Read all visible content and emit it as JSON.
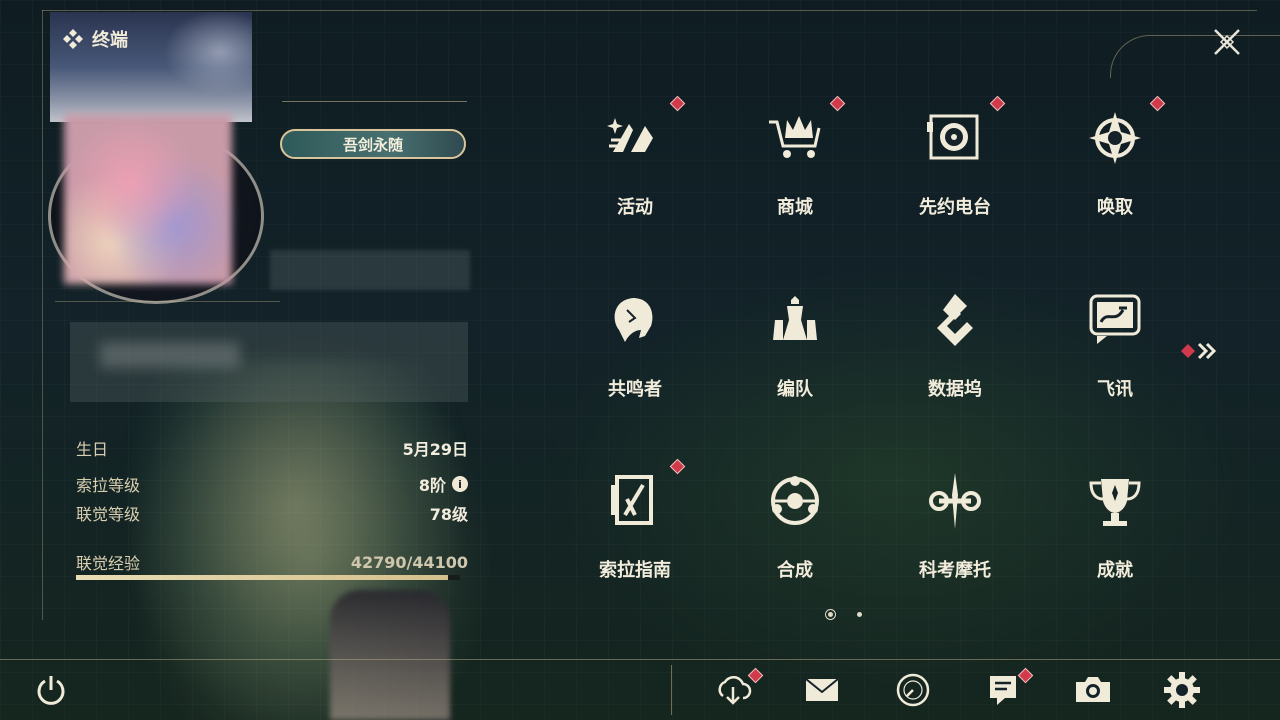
{
  "header": {
    "title": "终端"
  },
  "profile": {
    "title_badge": "吾剑永随",
    "stats": [
      {
        "label": "生日",
        "value": "5月29日"
      },
      {
        "label": "索拉等级",
        "value": "8阶"
      },
      {
        "label": "联觉等级",
        "value": "78级"
      }
    ],
    "exp": {
      "label": "联觉经验",
      "value": "42790/44100",
      "progress": 0.97
    },
    "info_icon": "i"
  },
  "menu": {
    "items": [
      {
        "label": "活动",
        "icon": "activity-icon",
        "badge": true
      },
      {
        "label": "商城",
        "icon": "shop-icon",
        "badge": true
      },
      {
        "label": "先约电台",
        "icon": "radio-icon",
        "badge": true
      },
      {
        "label": "唤取",
        "icon": "summon-icon",
        "badge": true
      },
      {
        "label": "共鸣者",
        "icon": "resonator-icon",
        "badge": false
      },
      {
        "label": "编队",
        "icon": "team-icon",
        "badge": false
      },
      {
        "label": "数据坞",
        "icon": "databank-icon",
        "badge": false
      },
      {
        "label": "飞讯",
        "icon": "message-icon",
        "badge": false
      },
      {
        "label": "索拉指南",
        "icon": "guide-icon",
        "badge": true
      },
      {
        "label": "合成",
        "icon": "synthesis-icon",
        "badge": false
      },
      {
        "label": "科考摩托",
        "icon": "motorcycle-icon",
        "badge": false
      },
      {
        "label": "成就",
        "icon": "achievement-icon",
        "badge": false
      }
    ],
    "page_current": 1,
    "page_count": 2
  },
  "bottom_bar": {
    "buttons": [
      "download-icon",
      "mail-icon",
      "clock-icon",
      "notice-icon",
      "camera-icon",
      "settings-icon"
    ]
  },
  "colors": {
    "accent_gold": "#d9c59a",
    "badge_red": "#d03a4a",
    "text": "#f2ecdc"
  }
}
